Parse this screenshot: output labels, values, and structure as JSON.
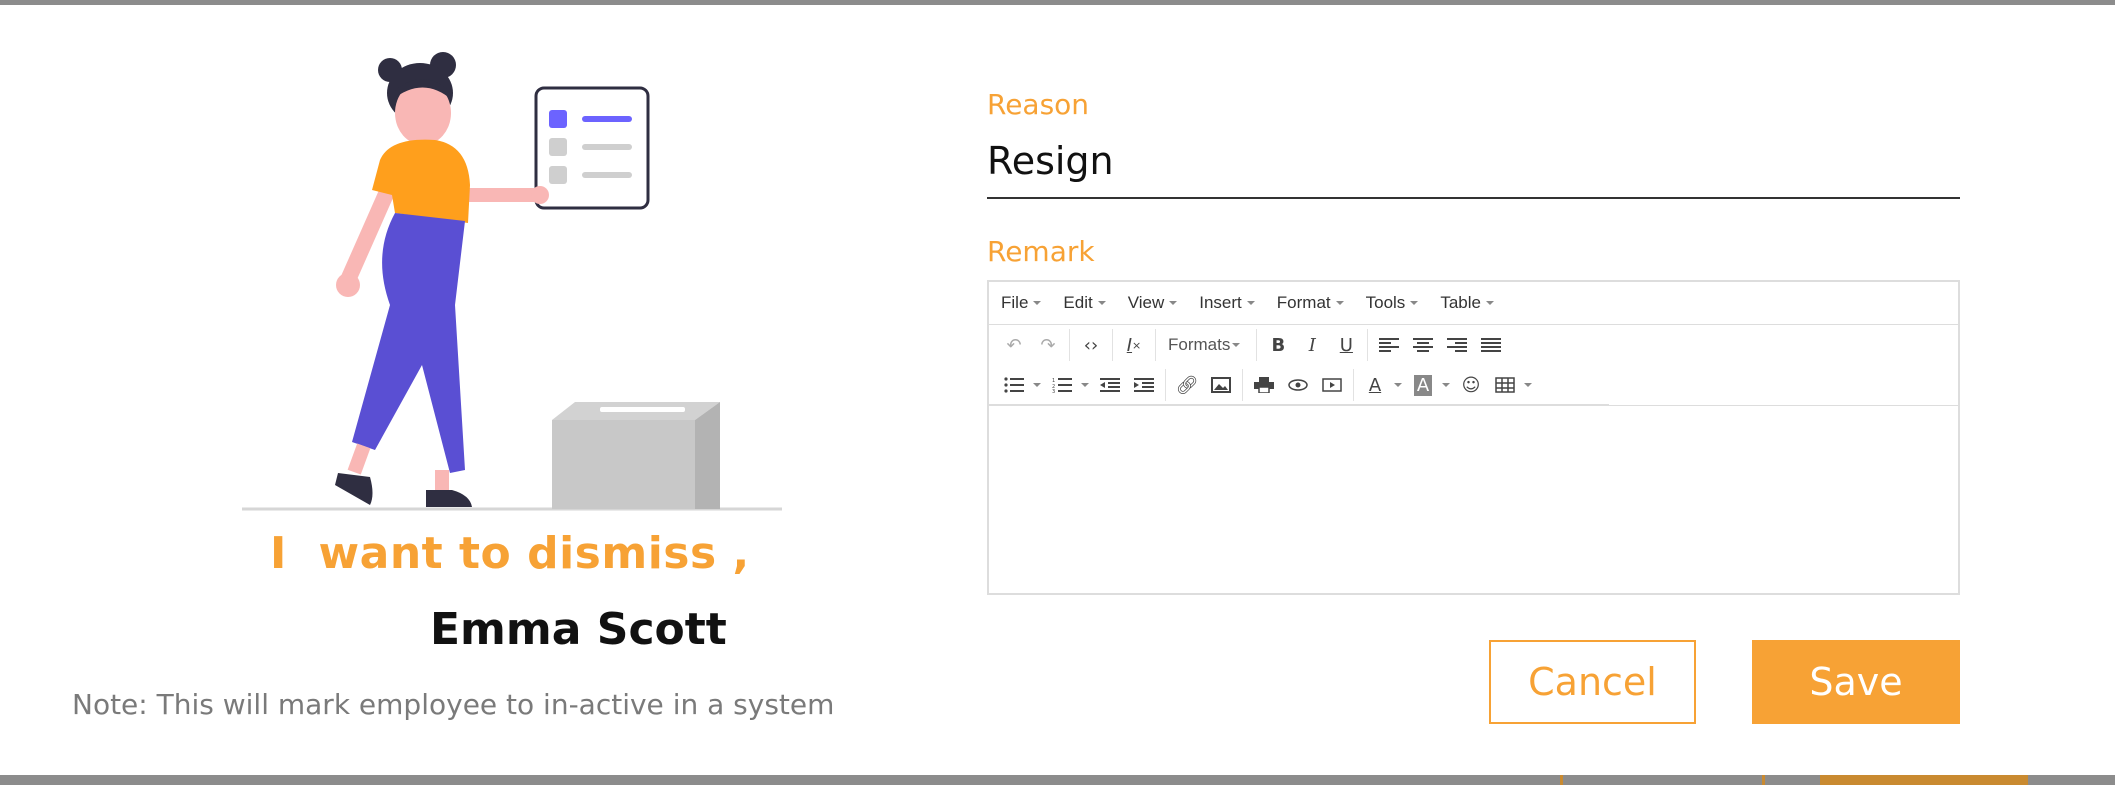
{
  "dialog": {
    "headline": "I  want to dismiss ,",
    "employee_name": "Emma Scott",
    "note": "Note: This will mark employee to in-active in a system"
  },
  "form": {
    "reason_label": "Reason",
    "reason_value": "Resign",
    "remark_label": "Remark"
  },
  "editor": {
    "menus": [
      "File",
      "Edit",
      "View",
      "Insert",
      "Format",
      "Tools",
      "Table"
    ],
    "formats_label": "Formats",
    "content": ""
  },
  "buttons": {
    "cancel_label": "Cancel",
    "save_label": "Save"
  },
  "colors": {
    "accent": "#f7a235",
    "illustration_purple": "#5a4fd3",
    "text_dark": "#111111",
    "note_gray": "#7a7a7a"
  }
}
